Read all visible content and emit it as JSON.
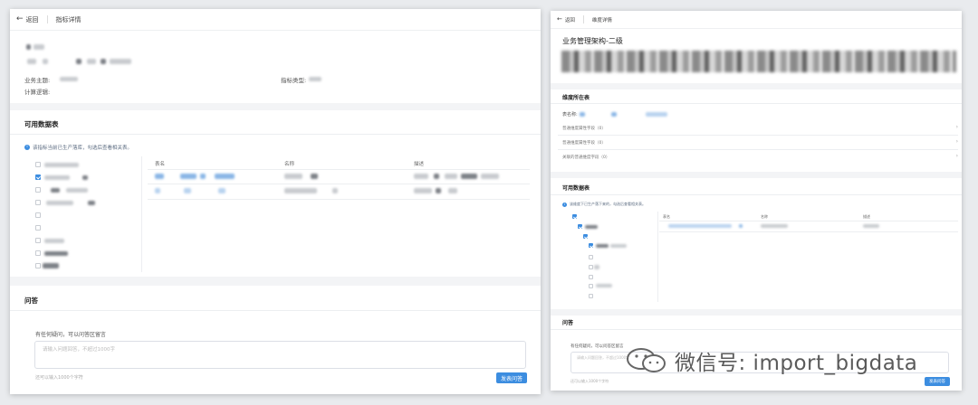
{
  "left_window": {
    "back_label": "返回",
    "breadcrumb_title": "指标详情",
    "fields": {
      "business_theme_label": "业务主题:",
      "metric_type_label": "指标类型:",
      "calc_logic_label": "计算逻辑:"
    },
    "available_tables": {
      "title": "可用数据表",
      "hint": "该指标当前已生产落库，勾选后查看相关表。",
      "columns": [
        "表名",
        "名称",
        "描述"
      ]
    },
    "qa": {
      "title": "问答",
      "prompt": "有任何疑问，可以问答区留言",
      "placeholder": "请输入问题回答，不超过1000字",
      "counter": "还可以输入1000个字符",
      "submit_label": "发表问答"
    }
  },
  "right_window": {
    "back_label": "返回",
    "breadcrumb_title": "维度详情",
    "heading": "业务管理架构-二级",
    "dimension_table": {
      "title": "维度所在表",
      "table_name_label": "表名称:",
      "rows": [
        "普通维度属性字段（0）",
        "普通维度属性字段（0）",
        "关联的普通维度字段（0）"
      ]
    },
    "available_tables": {
      "title": "可用数据表",
      "hint": "该维度下已生产落下来的，勾选后查看相关表。",
      "columns": [
        "表名",
        "名称",
        "描述"
      ]
    },
    "qa": {
      "title": "问答",
      "prompt": "有任何疑问，可以问答区留言",
      "placeholder": "请输入问题回答，不超过1000字",
      "counter": "还可以输入1000个字符",
      "submit_label": "发表问答"
    }
  },
  "watermark": {
    "account_text": "微信号: import_bigdata"
  },
  "colors": {
    "accent": "#3c8de0",
    "background": "#e9ebee"
  }
}
